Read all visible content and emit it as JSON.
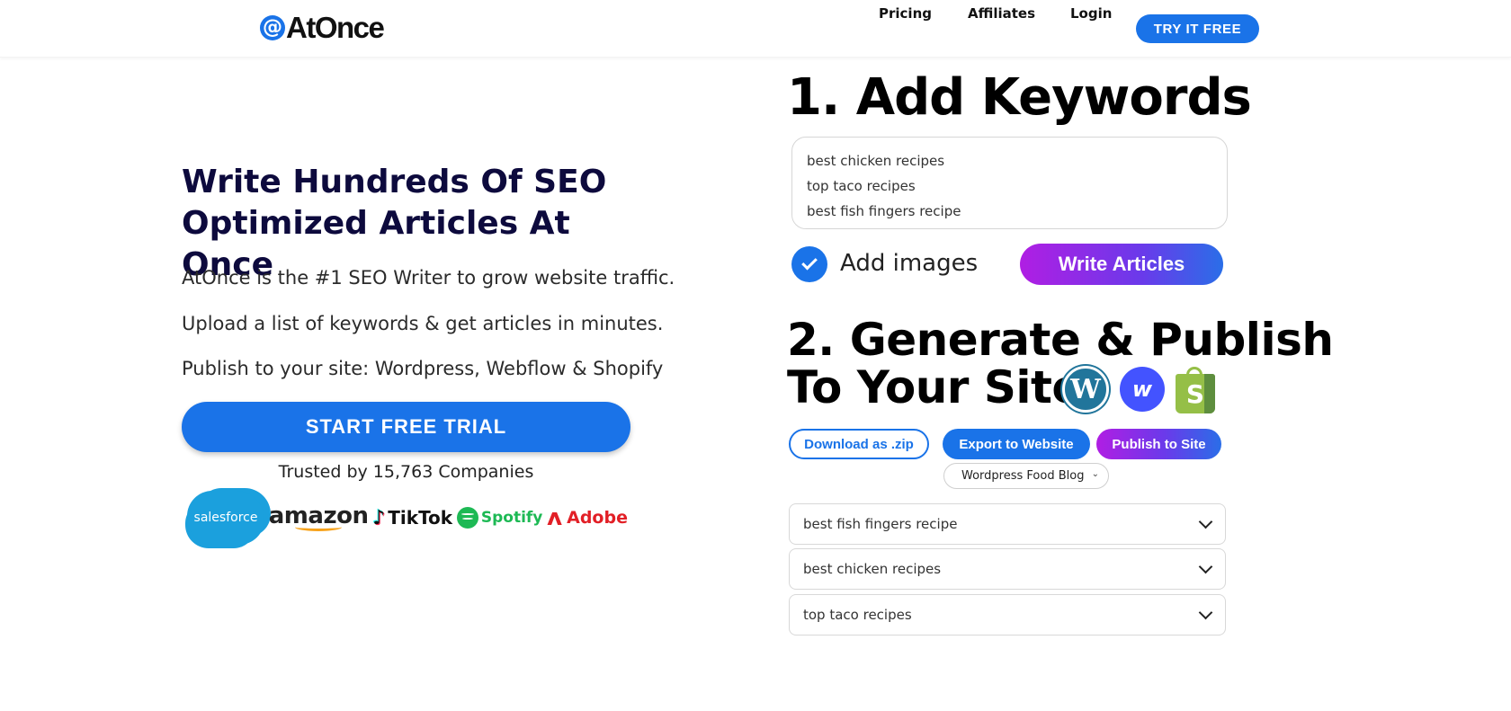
{
  "header": {
    "logo_symbol": "@",
    "logo_text": "AtOnce",
    "nav": [
      {
        "label": "Pricing"
      },
      {
        "label": "Affiliates"
      },
      {
        "label": "Login"
      }
    ],
    "cta_label": "TRY IT FREE"
  },
  "hero": {
    "title": "Write Hundreds Of SEO Optimized Articles At Once",
    "lines": [
      "AtOnce is the #1 SEO Writer to grow website traffic.",
      "Upload a list of keywords & get articles in minutes.",
      "Publish to your site: Wordpress, Webflow & Shopify"
    ],
    "cta_label": "START FREE TRIAL",
    "trusted_text": "Trusted by 15,763 Companies",
    "brands": [
      {
        "name": "salesforce",
        "icon": "salesforce-logo"
      },
      {
        "name": "amazon",
        "icon": "amazon-logo"
      },
      {
        "name": "TikTok",
        "icon": "tiktok-logo",
        "glyph": "♪"
      },
      {
        "name": "Spotify",
        "icon": "spotify-logo"
      },
      {
        "name": "Adobe",
        "icon": "adobe-logo",
        "glyph": "ʌ"
      }
    ]
  },
  "step1": {
    "title": "1. Add Keywords",
    "keywords": [
      "best chicken recipes",
      "top taco recipes",
      "best fish fingers recipe"
    ],
    "add_images_label": "Add images",
    "add_images_checked": true,
    "write_button_label": "Write Articles"
  },
  "step2": {
    "title_line1": "2. Generate & Publish",
    "title_line2": "To Your Site",
    "platforms": [
      {
        "name": "Wordpress",
        "icon": "wordpress-icon",
        "glyph": "W"
      },
      {
        "name": "Webflow",
        "icon": "webflow-icon",
        "glyph": "w"
      },
      {
        "name": "Shopify",
        "icon": "shopify-icon",
        "glyph": "S"
      }
    ],
    "download_label": "Download as .zip",
    "export_label": "Export to Website",
    "publish_label": "Publish to Site",
    "site_select_value": "Wordpress Food Blog",
    "articles": [
      "best fish fingers recipe",
      "best chicken recipes",
      "top taco recipes"
    ]
  },
  "colors": {
    "primary": "#1a73e8",
    "heading": "#0d0a3d",
    "gradient_start": "#b01ee3",
    "gradient_end": "#2a6ee8"
  }
}
